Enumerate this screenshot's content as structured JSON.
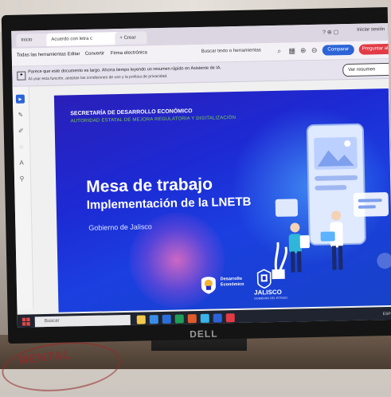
{
  "stamp": {
    "text": "MENTAL"
  },
  "monitor": {
    "brand": "DELL"
  },
  "browser": {
    "tabs": [
      {
        "label": "Inicio"
      },
      {
        "label": "Acuerdo con letra c"
      },
      {
        "label": "+ Crear"
      }
    ],
    "sign_in_label": "Iniciar sesión",
    "toolbar": {
      "menu": [
        "Todas las herramientas",
        "Editar",
        "Convertir",
        "Firma electrónica"
      ],
      "search_label": "Buscar texto o herramientas",
      "compare_label": "Comparar",
      "ask_label": "Preguntar al"
    },
    "notice": {
      "line1": "Parece que este documento es largo. Ahorra tiempo leyendo un resumen rápido en Asistente de IA.",
      "line2": "Al usar esta función, aceptas las condiciones de uso y la política de privacidad.",
      "summary_button": "Ver resumen"
    }
  },
  "slide": {
    "org_title": "SECRETARÍA DE DESARROLLO ECONÓMICO",
    "org_subtitle": "AUTORIDAD ESTATAL DE MEJORA REGULATORIA Y DIGITALIZACIÓN",
    "main_title": "Mesa de trabajo",
    "main_subtitle": "Implementación de la LNETB",
    "government_label": "Gobierno de Jalisco",
    "logo1_text": [
      "Desarrollo",
      "Económico"
    ],
    "logo2_text": "JALISCO",
    "logo2_sub": "GOBIERNO DEL ESTADO",
    "colors": {
      "background": "#1d2ad4",
      "accent_green": "#7fd04a"
    }
  },
  "taskbar": {
    "search_placeholder": "Buscar",
    "tray_text": "ESP"
  }
}
